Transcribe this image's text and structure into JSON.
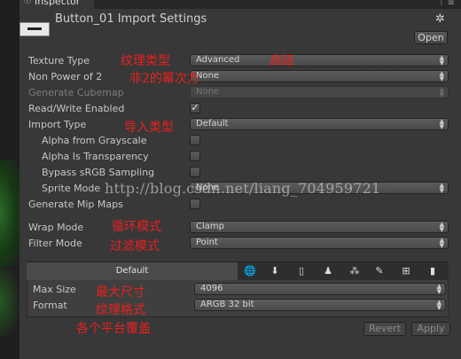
{
  "window": {
    "tab_label": "Inspector",
    "tab_menu": "⁝ ≡",
    "title": "Button_01 Import Settings",
    "open_label": "Open"
  },
  "settings": {
    "texture_type": {
      "label": "Texture Type",
      "value": "Advanced",
      "note": "高级"
    },
    "npot": {
      "label": "Non Power of 2",
      "value": "None"
    },
    "generate_cubemap": {
      "label": "Generate Cubemap",
      "value": "None"
    },
    "read_write": {
      "label": "Read/Write Enabled",
      "checked": true
    },
    "import_type": {
      "label": "Import Type",
      "value": "Default"
    },
    "alpha_from_grayscale": {
      "label": "Alpha from Grayscale",
      "checked": false
    },
    "alpha_is_transparency": {
      "label": "Alpha Is Transparency",
      "checked": false
    },
    "bypass_srgb": {
      "label": "Bypass sRGB Sampling",
      "checked": false
    },
    "sprite_mode": {
      "label": "Sprite Mode",
      "value": "None"
    },
    "generate_mip_maps": {
      "label": "Generate Mip Maps",
      "checked": false
    },
    "wrap_mode": {
      "label": "Wrap Mode",
      "value": "Clamp"
    },
    "filter_mode": {
      "label": "Filter Mode",
      "value": "Point"
    }
  },
  "annotations": {
    "texture_type": "纹理类型",
    "npot": "非2的幂次方",
    "import_type": "导入类型",
    "wrap_mode": "循环模式",
    "filter_mode": "过滤模式",
    "max_size": "最大尺寸",
    "format": "纹理格式",
    "platforms": "各个平台覆盖"
  },
  "platforms": {
    "default_label": "Default",
    "icons": [
      "globe-icon",
      "download-icon",
      "phone-icon",
      "android-icon",
      "blackberry-icon",
      "flash-icon",
      "windows-icon",
      "device-icon"
    ],
    "glyphs": [
      "🌐",
      "⬇",
      "▯",
      "♟",
      "⁂",
      "✎",
      "⊞",
      "▮"
    ]
  },
  "platform_settings": {
    "max_size": {
      "label": "Max Size",
      "value": "4096"
    },
    "format": {
      "label": "Format",
      "value": "ARGB 32 bit"
    }
  },
  "buttons": {
    "revert": "Revert",
    "apply": "Apply"
  },
  "watermark": "http://blog.csdn.net/liang_704959721"
}
